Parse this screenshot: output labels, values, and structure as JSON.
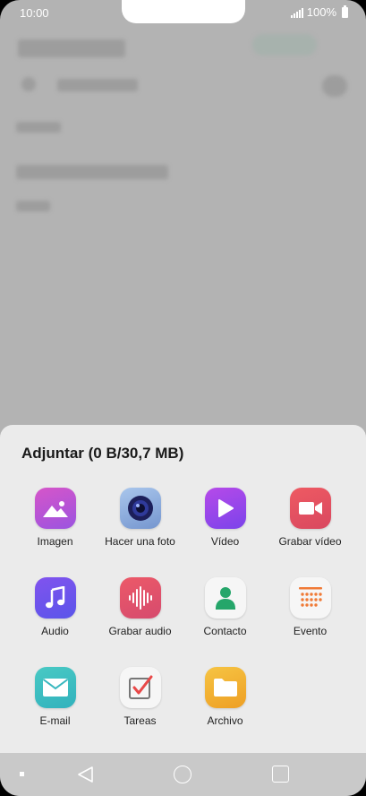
{
  "status_bar": {
    "time": "10:00",
    "battery": "100%"
  },
  "sheet": {
    "title": "Adjuntar (0 B/30,7 MB)",
    "items": [
      {
        "label": "Imagen",
        "icon": "image-icon",
        "color": "#c94fce"
      },
      {
        "label": "Hacer una foto",
        "icon": "camera-icon",
        "color": "#8fb0dd"
      },
      {
        "label": "Vídeo",
        "icon": "video-play-icon",
        "color": "#9b44ea"
      },
      {
        "label": "Grabar vídeo",
        "icon": "video-camera-icon",
        "color": "#e8515e"
      },
      {
        "label": "Audio",
        "icon": "music-note-icon",
        "color": "#6b54ee"
      },
      {
        "label": "Grabar audio",
        "icon": "soundwave-icon",
        "color": "#e2506a"
      },
      {
        "label": "Contacto",
        "icon": "contact-icon",
        "color": "#f4f4f4"
      },
      {
        "label": "Evento",
        "icon": "calendar-icon",
        "color": "#f4f4f4"
      },
      {
        "label": "E-mail",
        "icon": "mail-icon",
        "color": "#3fc0c0"
      },
      {
        "label": "Tareas",
        "icon": "tasks-icon",
        "color": "#f4f4f4"
      },
      {
        "label": "Archivo",
        "icon": "folder-icon",
        "color": "#f2b233"
      }
    ]
  }
}
